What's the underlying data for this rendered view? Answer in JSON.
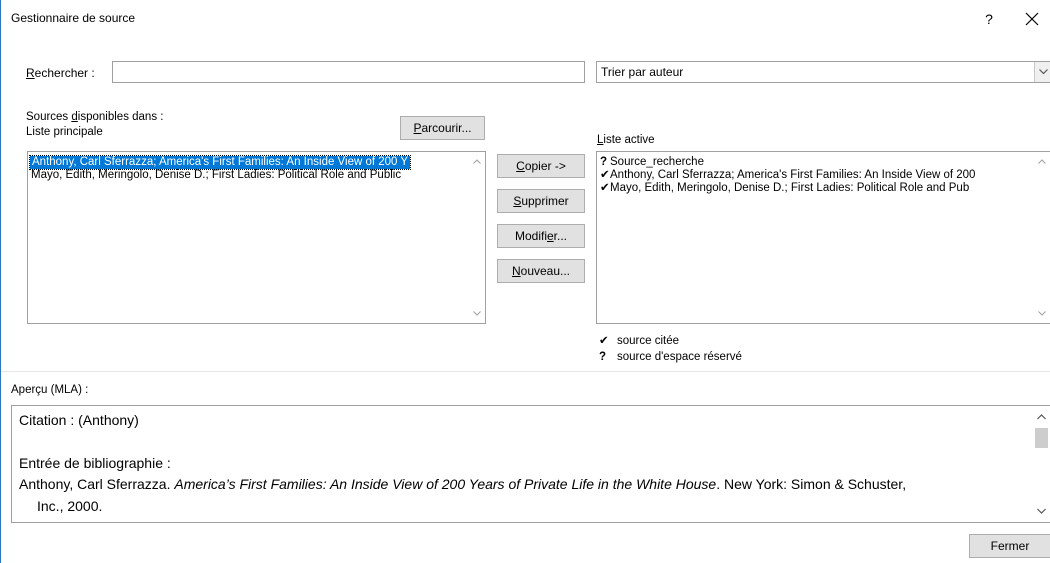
{
  "window": {
    "title": "Gestionnaire de source",
    "help": "?"
  },
  "search": {
    "label_u": "R",
    "label_rest": "echercher :",
    "value": "",
    "placeholder": ""
  },
  "sort": {
    "selected": "Trier par auteur"
  },
  "sources": {
    "label_line1_pre": "Sources ",
    "label_line1_u": "d",
    "label_line1_post": "isponibles dans :",
    "label_line2": "Liste principale",
    "browse_u": "P",
    "browse_rest": "arcourir...",
    "items": [
      "Anthony, Carl Sferrazza; America's First Families: An Inside View of 200 Y",
      "Mayo, Edith, Meringolo, Denise D.; First Ladies: Political Role and Public"
    ]
  },
  "actions": {
    "copy_u": "C",
    "copy_rest": "opier ->",
    "delete_u": "S",
    "delete_rest": "upprimer",
    "edit_pre": "Modifi",
    "edit_u": "e",
    "edit_post": "r...",
    "new_u": "N",
    "new_rest": "ouveau..."
  },
  "active": {
    "label_u": "L",
    "label_rest": "iste active",
    "items": [
      {
        "mark": "?",
        "text": "Source_recherche"
      },
      {
        "mark": "✔",
        "text": "Anthony, Carl Sferrazza; America's First Families: An Inside View of 200"
      },
      {
        "mark": "✔",
        "text": "Mayo, Edith, Meringolo, Denise D.; First Ladies: Political Role and Pub"
      }
    ]
  },
  "legend": {
    "cited_mark": "✔",
    "cited": "source citée",
    "placeholder_mark": "?",
    "placeholder": "source d'espace réservé"
  },
  "preview": {
    "label": "Aperçu (MLA) :",
    "citation": "Citation :  (Anthony)",
    "bib_label": "Entrée de bibliographie :",
    "entry_pre": "Anthony, Carl Sferrazza. ",
    "entry_title": "America’s First Families: An Inside View of 200 Years of Private Life in the White House",
    "entry_post": ". New York: Simon & Schuster,",
    "entry_line2": "Inc., 2000."
  },
  "footer": {
    "close": "Fermer"
  }
}
